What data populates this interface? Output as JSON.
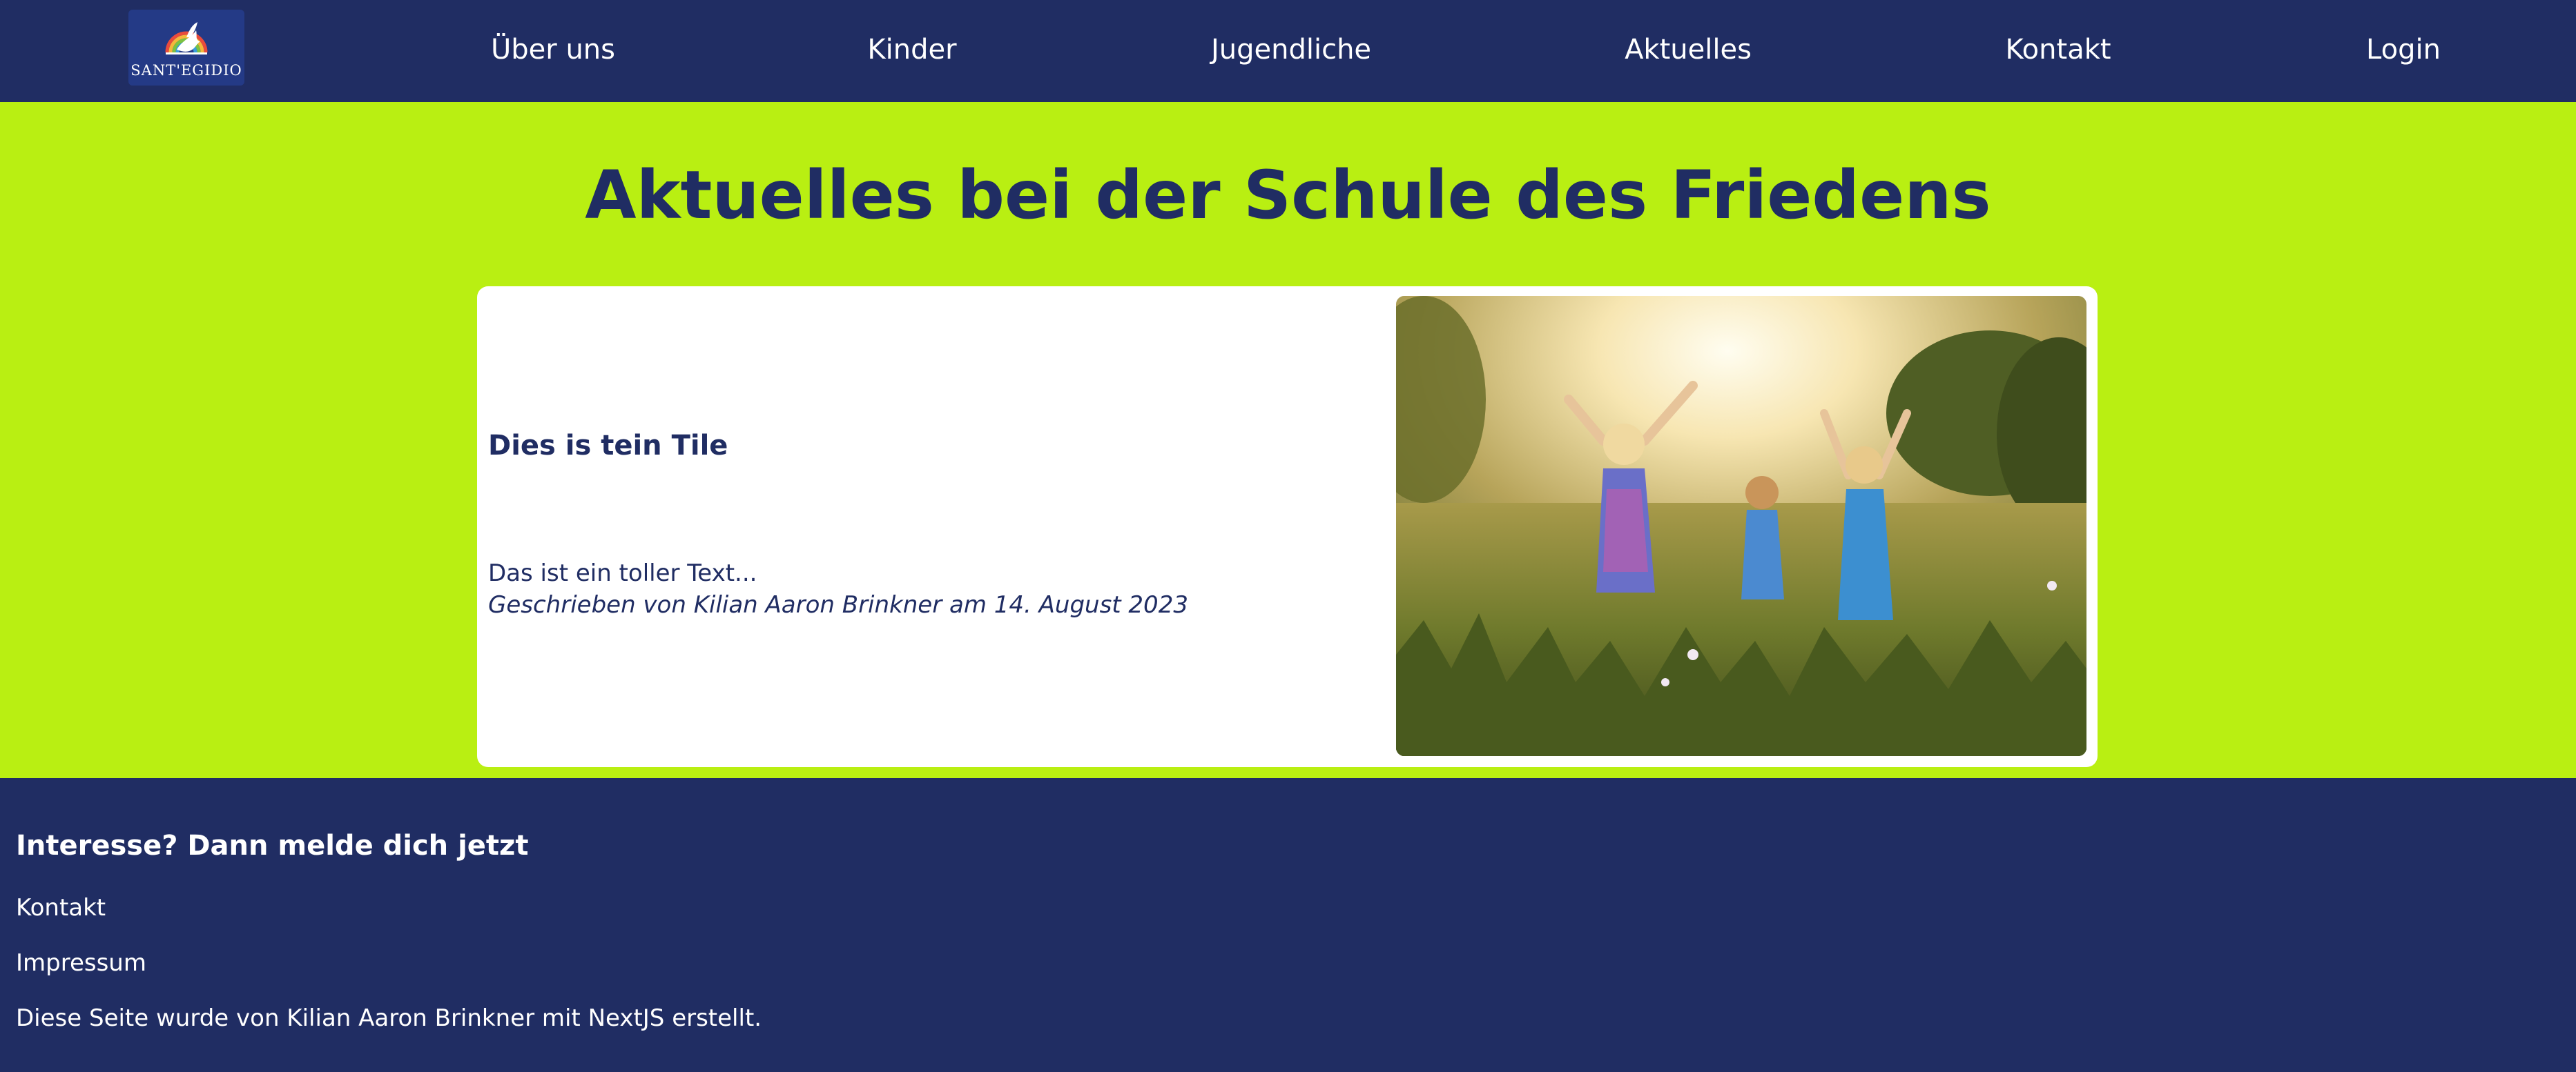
{
  "nav": {
    "logo_text": "SANT'EGIDIO",
    "items": [
      {
        "label": "Über uns"
      },
      {
        "label": "Kinder"
      },
      {
        "label": "Jugendliche"
      },
      {
        "label": "Aktuelles"
      },
      {
        "label": "Kontakt"
      },
      {
        "label": "Login"
      }
    ]
  },
  "main": {
    "title": "Aktuelles bei der Schule des Friedens",
    "post": {
      "title": "Dies is tein Tile",
      "text": "Das ist ein toller Text...",
      "byline": "Geschrieben von Kilian Aaron Brinkner am 14. August 2023",
      "image_icon": "children-in-meadow-photo"
    }
  },
  "footer": {
    "heading": "Interesse? Dann melde dich jetzt",
    "links": [
      {
        "label": "Kontakt"
      },
      {
        "label": "Impressum"
      }
    ],
    "note": "Diese Seite wurde von Kilian Aaron Brinkner mit NextJS erstellt."
  },
  "colors": {
    "navy": "#202d63",
    "lime": "#b9ef12",
    "white": "#ffffff"
  }
}
